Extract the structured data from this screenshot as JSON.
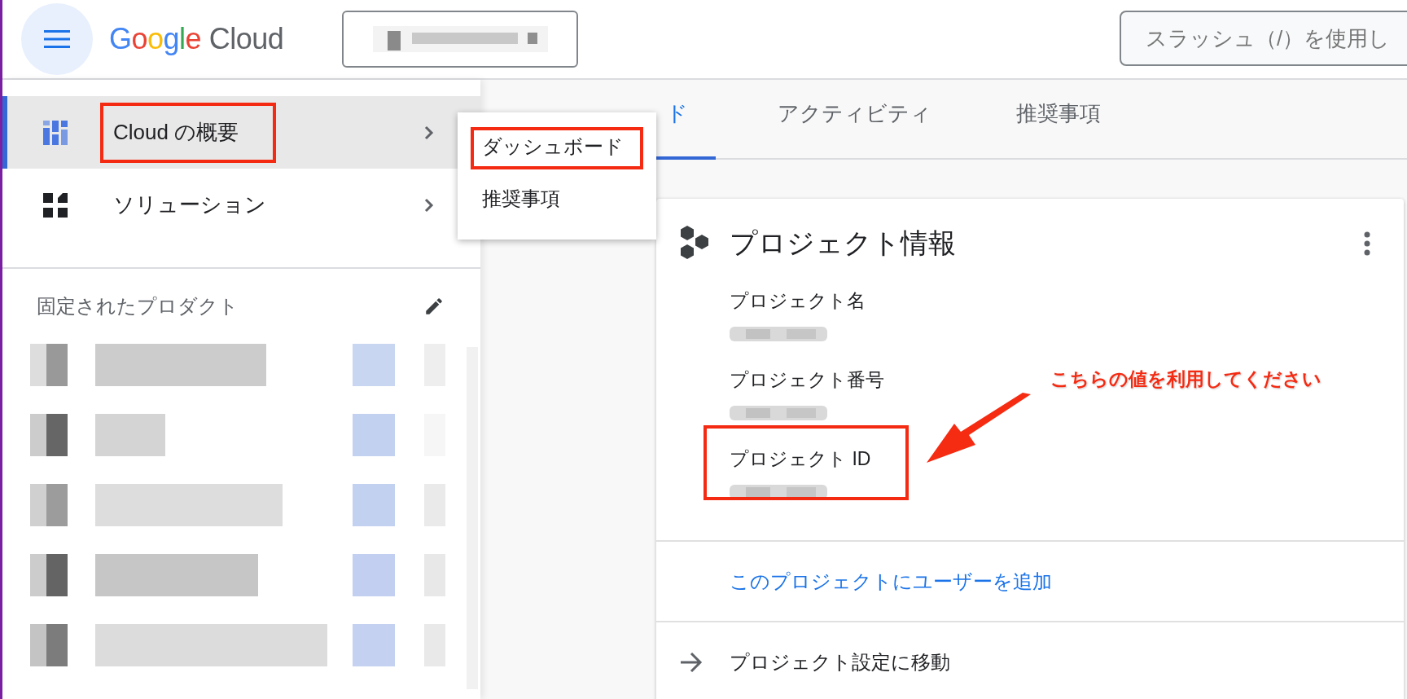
{
  "top_bar": {
    "logo": {
      "brand": "Google",
      "product": "Cloud"
    },
    "search": {
      "placeholder": "スラッシュ（/）を使用し"
    }
  },
  "nav": {
    "items": [
      {
        "label": "Cloud の概要",
        "selected": true,
        "highlighted": true
      },
      {
        "label": "ソリューション",
        "selected": false,
        "highlighted": false
      }
    ],
    "pinned": {
      "title": "固定されたプロダクト"
    }
  },
  "submenu": {
    "items": [
      {
        "label": "ダッシュボード",
        "highlighted": true
      },
      {
        "label": "推奨事項",
        "highlighted": false
      }
    ]
  },
  "tabs": [
    {
      "label": "ド",
      "selected": true
    },
    {
      "label": "アクティビティ",
      "selected": false
    },
    {
      "label": "推奨事項",
      "selected": false
    }
  ],
  "card": {
    "title": "プロジェクト情報",
    "fields": [
      {
        "label": "プロジェクト名",
        "highlighted": false
      },
      {
        "label": "プロジェクト番号",
        "highlighted": false
      },
      {
        "label": "プロジェクト ID",
        "highlighted": true
      }
    ],
    "link": "このプロジェクトにユーザーを追加",
    "action": "プロジェクト設定に移動"
  },
  "callout": {
    "text": "こちらの値を利用してください"
  }
}
